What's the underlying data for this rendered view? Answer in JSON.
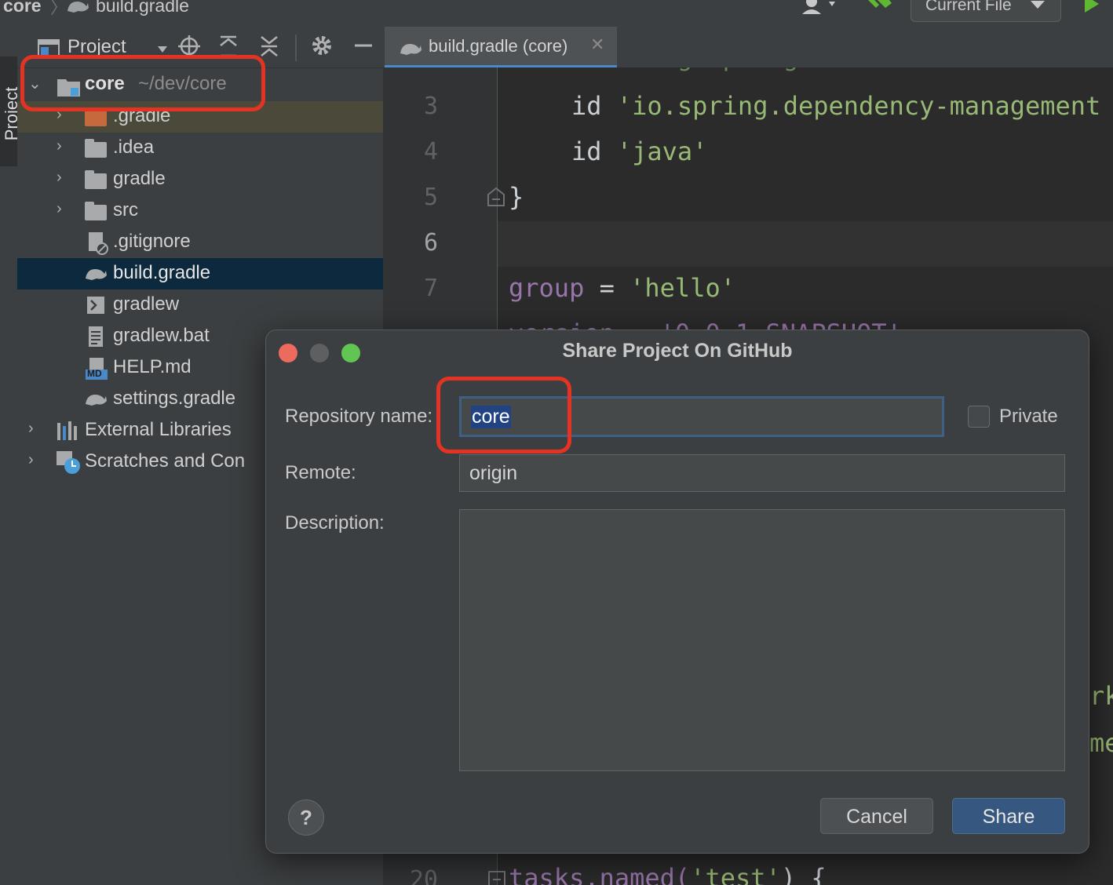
{
  "breadcrumb": {
    "project": "core",
    "file": "build.gradle",
    "run_config": "Current File"
  },
  "left_strip": {
    "label": "Project"
  },
  "project_panel": {
    "title": "Project",
    "root": {
      "name": "core",
      "path": "~/dev/core"
    },
    "items": [
      {
        "label": ".gradle"
      },
      {
        "label": ".idea"
      },
      {
        "label": "gradle"
      },
      {
        "label": "src"
      },
      {
        "label": ".gitignore"
      },
      {
        "label": "build.gradle"
      },
      {
        "label": "gradlew"
      },
      {
        "label": "gradlew.bat"
      },
      {
        "label": "HELP.md"
      },
      {
        "label": "settings.gradle"
      },
      {
        "label": "External Libraries"
      },
      {
        "label": "Scratches and Con"
      }
    ],
    "md_badge": "MD"
  },
  "editor": {
    "tab_label": "build.gradle (core)",
    "line_numbers": [
      "3",
      "4",
      "5",
      "6",
      "7",
      "20"
    ],
    "code": {
      "l3_kw": "id",
      "l3_str": "'io.spring.dependency-management",
      "l4_kw": "id",
      "l4_str": "'java'",
      "l5": "}",
      "l7_prop": "group",
      "l7_op": "=",
      "l7_str": "'hello'",
      "l20_a": "tasks.named(",
      "l20_str": "'test'",
      "l20_b": ") {",
      "frag1": "rk",
      "frag2": "me"
    }
  },
  "dialog": {
    "title": "Share Project On GitHub",
    "repo_label": "Repository name:",
    "repo_value": "core",
    "private_label": "Private",
    "remote_label": "Remote:",
    "remote_value": "origin",
    "description_label": "Description:",
    "description_value": "",
    "help": "?",
    "cancel": "Cancel",
    "share": "Share"
  },
  "colors": {
    "accent": "#4a88c7",
    "callout": "#e53323",
    "share_button": "#365880",
    "traffic_close": "#ed6a5e",
    "traffic_min": "#5d5f61",
    "traffic_max": "#61c554"
  }
}
